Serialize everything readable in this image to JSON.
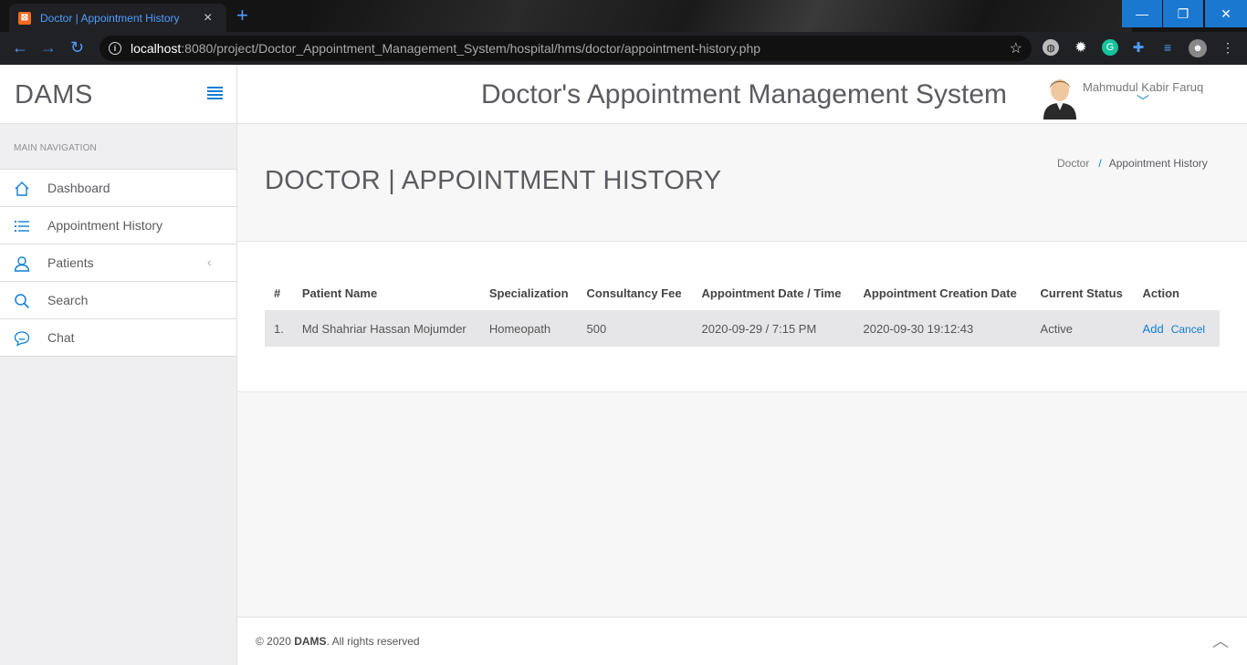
{
  "browser": {
    "tab_title": "Doctor | Appointment History",
    "url_host": "localhost",
    "url_path": ":8080/project/Doctor_Appointment_Management_System/hospital/hms/doctor/appointment-history.php"
  },
  "header": {
    "brand": "DAMS",
    "system_title": "Doctor's Appointment Management System",
    "user_name": "Mahmudul Kabir Faruq"
  },
  "sidebar": {
    "heading": "MAIN NAVIGATION",
    "items": [
      {
        "label": "Dashboard",
        "icon": "home-icon"
      },
      {
        "label": "Appointment History",
        "icon": "list-icon"
      },
      {
        "label": "Patients",
        "icon": "user-icon"
      },
      {
        "label": "Search",
        "icon": "search-icon"
      },
      {
        "label": "Chat",
        "icon": "chat-icon"
      }
    ]
  },
  "page": {
    "title": "DOCTOR | APPOINTMENT HISTORY",
    "breadcrumb": [
      "Doctor",
      "Appointment History"
    ]
  },
  "table": {
    "headers": [
      "#",
      "Patient Name",
      "Specialization",
      "Consultancy Fee",
      "Appointment Date / Time",
      "Appointment Creation Date",
      "Current Status",
      "Action"
    ],
    "rows": [
      {
        "num": "1.",
        "patient": "Md Shahriar Hassan Mojumder",
        "specialization": "Homeopath",
        "fee": "500",
        "appointment": "2020-09-29 / 7:15 PM",
        "created": "2020-09-30 19:12:43",
        "status": "Active",
        "action_add": "Add",
        "action_cancel": "Cancel"
      }
    ]
  },
  "footer": {
    "prefix": "© 2020 ",
    "brand": "DAMS",
    "suffix": ". All rights reserved"
  },
  "colors": {
    "accent": "#0e7fd6",
    "sidebar_bg": "#efeff1",
    "row_bg": "#e6e6e8"
  }
}
